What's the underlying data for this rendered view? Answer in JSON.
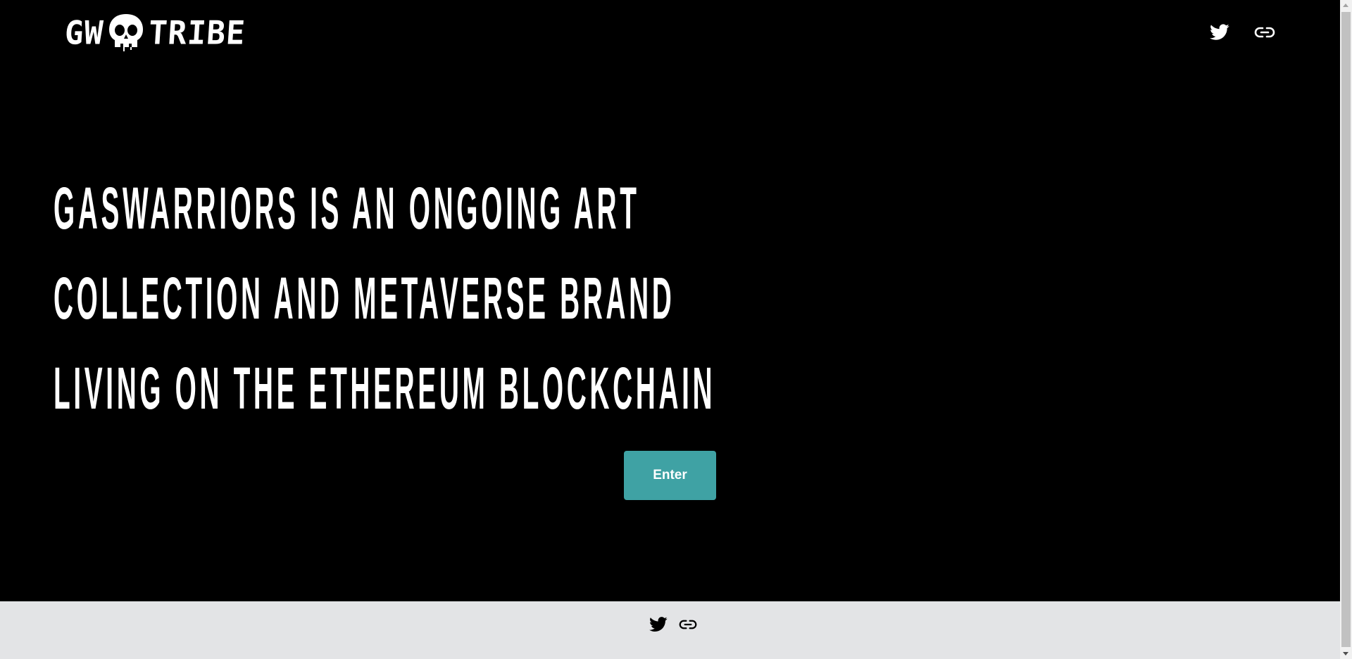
{
  "header": {
    "logo_left": "GW",
    "logo_right": "TRIBE",
    "icons": [
      "twitter-icon",
      "link-icon"
    ]
  },
  "hero": {
    "lines": [
      "Gaswarriors is an ongoing art",
      "collection and metaverse brand",
      "living on the ethereum blockchain"
    ],
    "enter_label": "Enter"
  },
  "footer": {
    "icons": [
      "twitter-icon",
      "link-icon"
    ]
  },
  "colors": {
    "background": "#000000",
    "text": "#ffffff",
    "accent": "#3fa2a4",
    "footer_bg": "#e3e4e6",
    "footer_icon": "#000000"
  }
}
